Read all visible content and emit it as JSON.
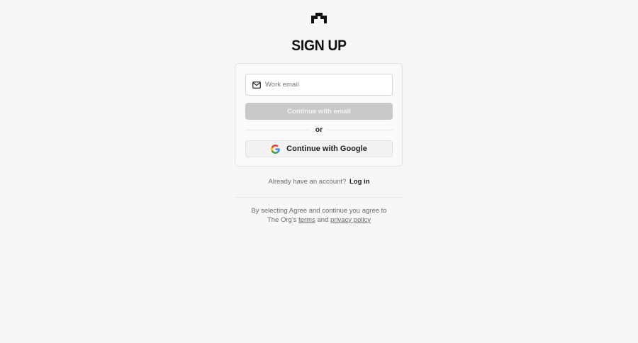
{
  "header": {
    "logo_icon": "the-org-logo",
    "title": "SIGN UP"
  },
  "form": {
    "email_icon": "mail-icon",
    "email_placeholder": "Work email",
    "email_value": "",
    "continue_email_label": "Continue with email",
    "divider_text": "or",
    "google_icon": "google-icon",
    "continue_google_label": "Continue with Google"
  },
  "account": {
    "prompt": "Already have an account?",
    "login_label": "Log in"
  },
  "legal": {
    "prefix": "By selecting Agree and continue you agree to The Org's",
    "terms_label": "terms",
    "conjunction": "and",
    "privacy_label": "privacy policy"
  },
  "colors": {
    "background": "#f7f7f7",
    "disabled_button": "#c9c9c9",
    "text_primary": "#1a1a1a",
    "text_muted": "#6a6a6a"
  }
}
